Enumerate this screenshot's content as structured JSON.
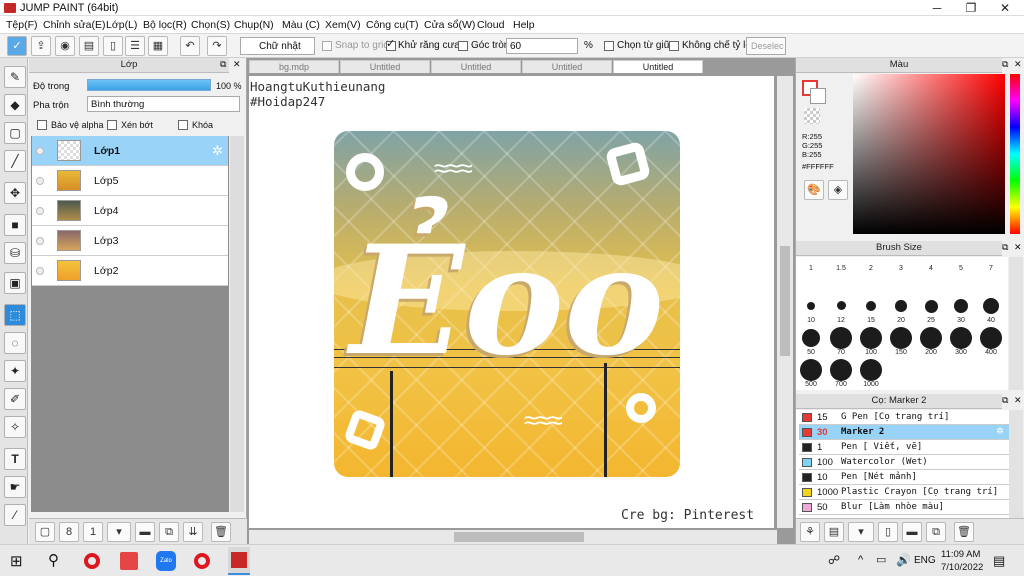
{
  "window": {
    "title": "JUMP PAINT (64bit)"
  },
  "menu": [
    "Tệp(F)",
    "Chỉnh sửa(E)",
    "Lớp(L)",
    "Bộ lọc(R)",
    "Chọn(S)",
    "Chụp(N)",
    "Màu (C)",
    "Xem(V)",
    "Công cụ(T)",
    "Cửa sổ(W)",
    "Cloud",
    "Help"
  ],
  "toolbar": {
    "shape": "Chữ nhật",
    "snap_to_grid": "Snap to grid",
    "antialias": "Khử răng cưa",
    "rounded": "Góc tròn",
    "rounded_value": "60",
    "percent": "%",
    "center_select": "Chọn từ giữa",
    "no_ratio": "Không chế tỷ lệ",
    "deselect": "Deselec"
  },
  "layers": {
    "title": "Lớp",
    "opacity_label": "Độ trong",
    "opacity_value": "100 %",
    "blend_label": "Pha trộn",
    "blend_value": "Bình thường",
    "protect_alpha": "Bảo vệ alpha",
    "clip": "Xén bớt",
    "lock": "Khóa",
    "items": [
      "Lớp1",
      "Lớp5",
      "Lớp4",
      "Lớp3",
      "Lớp2"
    ]
  },
  "doc_tabs": [
    "bg.mdp",
    "Untitled",
    "Untitled",
    "Untitled",
    "Untitled"
  ],
  "canvas": {
    "watermark1": "HoangtuKuthieunang",
    "watermark2": "#Hoidap247",
    "credit": "Cre bg: Pinterest",
    "art_text": "Ẻoo"
  },
  "color": {
    "title": "Màu",
    "r": "R:255",
    "g": "G:255",
    "b": "B:255",
    "hex": "#FFFFFF",
    "current": "#ffffff",
    "accent": "#e53935"
  },
  "brush_size": {
    "title": "Brush Size",
    "sizes": [
      "1",
      "1.5",
      "2",
      "3",
      "4",
      "5",
      "7",
      "10",
      "12",
      "15",
      "20",
      "25",
      "30",
      "40",
      "50",
      "70",
      "100",
      "150",
      "200",
      "300",
      "400",
      "500",
      "700",
      "1000"
    ]
  },
  "brushes": {
    "title": "Cọ: Marker 2",
    "items": [
      {
        "size": "15",
        "name": "G Pen [Cọ trang trí]",
        "color": "#e53935"
      },
      {
        "size": "30",
        "name": "Marker 2",
        "color": "#e53935"
      },
      {
        "size": "1",
        "name": "Pen [ Viết, vẽ]",
        "color": "#222222"
      },
      {
        "size": "100",
        "name": "Watercolor (Wet)",
        "color": "#7fd3f5"
      },
      {
        "size": "10",
        "name": "Pen [Nét mảnh]",
        "color": "#222222"
      },
      {
        "size": "1000",
        "name": "Plastic Crayon [Cọ trang trí]",
        "color": "#f2d21b"
      },
      {
        "size": "50",
        "name": "Blur [Làm nhòe màu]",
        "color": "#f0a8d8"
      }
    ]
  },
  "taskbar": {
    "lang": "ENG",
    "time": "11:09 AM",
    "date": "7/10/2022"
  }
}
